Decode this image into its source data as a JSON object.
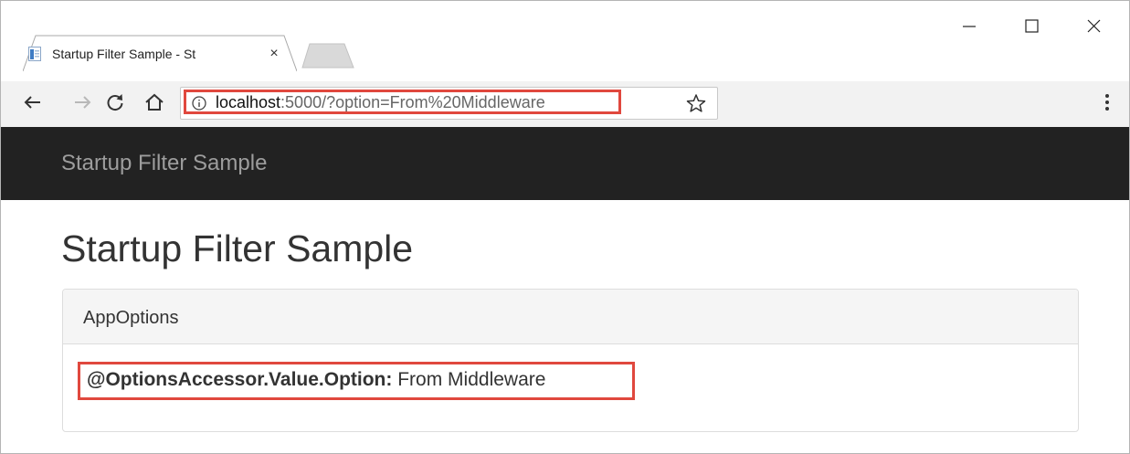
{
  "browser": {
    "tab": {
      "title": "Startup Filter Sample - St",
      "close_glyph": "×"
    },
    "window_controls": {
      "minimize_icon": "minimize-icon",
      "maximize_icon": "maximize-icon",
      "close_icon": "close-icon"
    },
    "toolbar": {
      "back_icon": "back-arrow-icon",
      "forward_icon": "forward-arrow-icon",
      "reload_icon": "reload-icon",
      "home_icon": "home-icon",
      "url_host": "localhost",
      "url_rest": ":5000/?option=From%20Middleware",
      "info_icon": "info-icon",
      "bookmark_icon": "star-icon",
      "menu_icon": "more-vert-icon"
    },
    "annotation_color": "#e0483e"
  },
  "page": {
    "navbar": {
      "brand": "Startup Filter Sample",
      "background": "#222222"
    },
    "title": "Startup Filter Sample",
    "panel": {
      "heading": "AppOptions",
      "option_key": "@OptionsAccessor.Value.Option:",
      "option_value": " From Middleware"
    }
  }
}
